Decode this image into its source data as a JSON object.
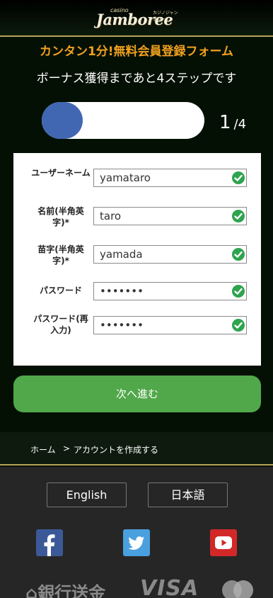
{
  "header": {
    "logo_small": "casino",
    "logo_main": "Jamboree",
    "logo_kana": "カジノジャンボリー"
  },
  "form": {
    "title": "カンタン1分!無料会員登録フォーム",
    "subtitle": "ボーナス獲得まであと4ステップです",
    "progress": {
      "fraction": 0.25,
      "fill_color": "#4267b2"
    },
    "step_current": "1",
    "step_total": "/4",
    "fields": [
      {
        "label": "ユーザーネーム",
        "value": "yamataro",
        "valid": true
      },
      {
        "label": "名前(半角英字)*",
        "value": "taro",
        "valid": true
      },
      {
        "label": "苗字(半角英字)*",
        "value": "yamada",
        "valid": true
      },
      {
        "label": "パスワード",
        "value": "•••••••",
        "valid": true
      },
      {
        "label": "パスワード(再入力)",
        "value": "•••••••",
        "valid": true
      }
    ],
    "next_label": "次へ進む"
  },
  "breadcrumb": {
    "home": "ホーム",
    "separator": ">",
    "current": "アカウントを作成する"
  },
  "footer": {
    "lang_en": "English",
    "lang_ja": "日本語",
    "social": [
      "facebook-icon",
      "twitter-icon",
      "youtube-icon"
    ],
    "payments": {
      "bank": "銀行送金",
      "visa": "VISA"
    }
  },
  "colors": {
    "accent": "#f0a01e",
    "button": "#51a84a",
    "check": "#2ea44f",
    "gold_border": "#b8a15a"
  }
}
